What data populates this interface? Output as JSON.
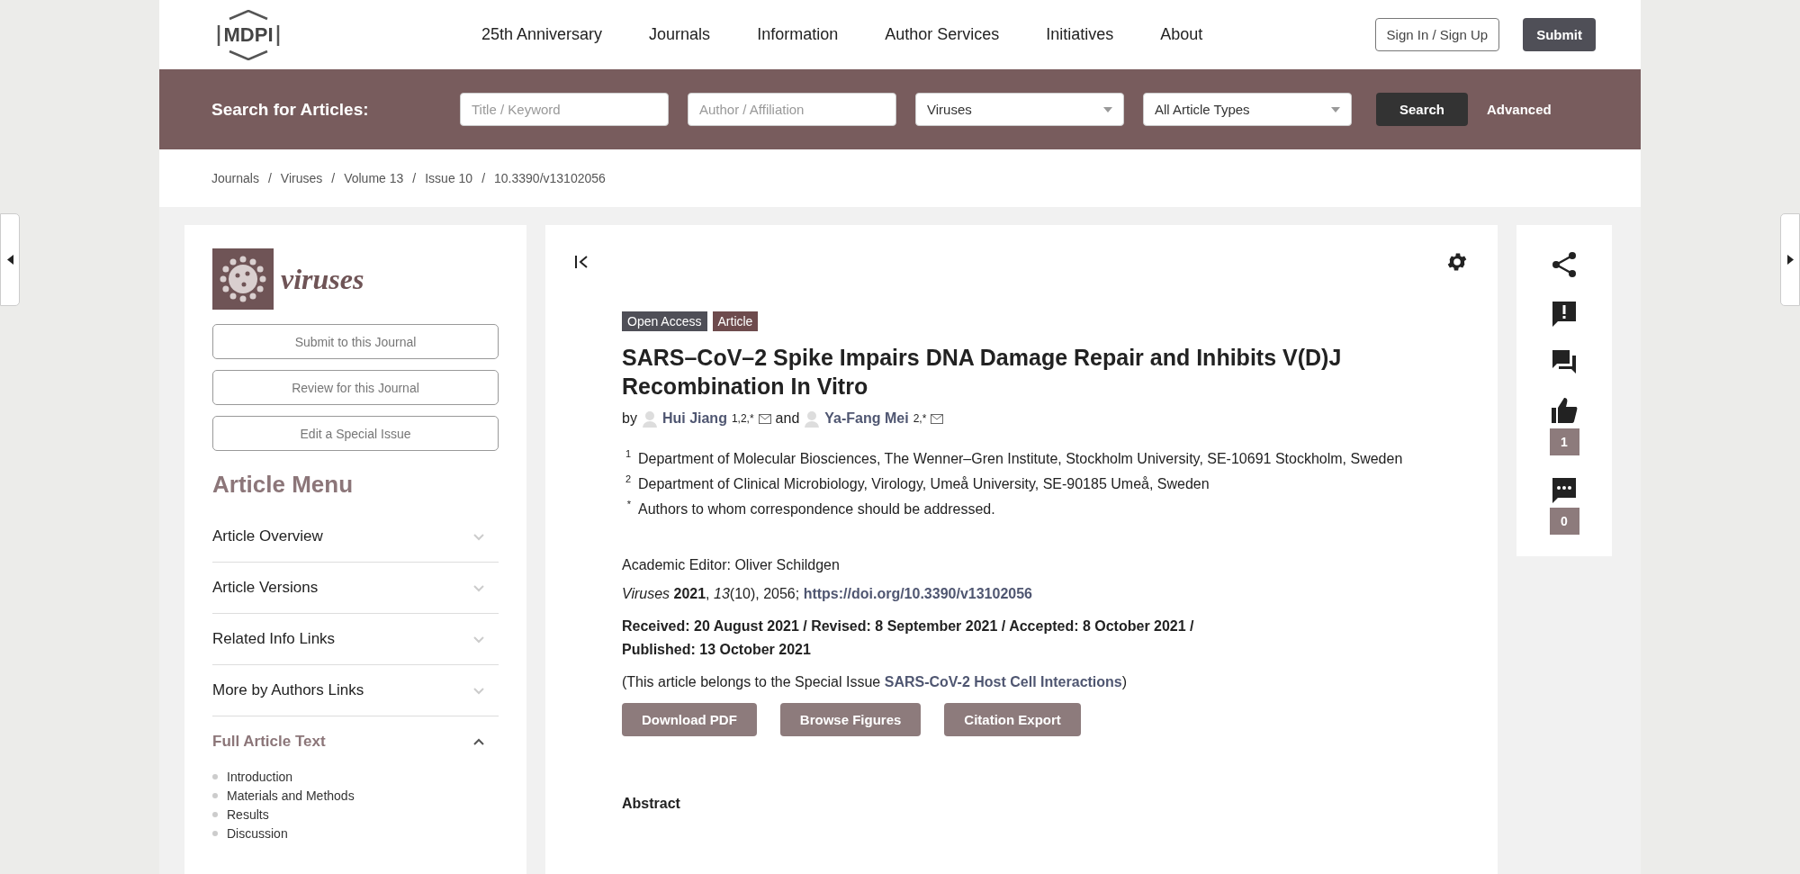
{
  "header": {
    "logo": "MDPI",
    "nav": [
      "25th Anniversary",
      "Journals",
      "Information",
      "Author Services",
      "Initiatives",
      "About"
    ],
    "sign_in": "Sign In / Sign Up",
    "submit": "Submit"
  },
  "search": {
    "label": "Search for Articles:",
    "fields": [
      {
        "kind": "text",
        "placeholder": "Title / Keyword"
      },
      {
        "kind": "text",
        "placeholder": "Author / Affiliation"
      },
      {
        "kind": "select",
        "value": "Viruses"
      },
      {
        "kind": "select",
        "value": "All Article Types"
      }
    ],
    "button": "Search",
    "advanced": "Advanced"
  },
  "breadcrumb": {
    "separator": "/",
    "items": [
      "Journals",
      "Viruses",
      "Volume 13",
      "Issue 10",
      "10.3390/v13102056"
    ]
  },
  "sidebar": {
    "journal": "viruses",
    "buttons": [
      "Submit to this Journal",
      "Review for this Journal",
      "Edit a Special Issue"
    ],
    "menu_title": "Article Menu",
    "menu": [
      {
        "label": "Article Overview",
        "expanded": false
      },
      {
        "label": "Article Versions",
        "expanded": false
      },
      {
        "label": "Related Info Links",
        "expanded": false
      },
      {
        "label": "More by Authors Links",
        "expanded": false
      },
      {
        "label": "Full Article Text",
        "expanded": true,
        "children": [
          "Introduction",
          "Materials and Methods",
          "Results",
          "Discussion"
        ]
      }
    ]
  },
  "article": {
    "badges": [
      {
        "label": "Open Access",
        "kind": "access"
      },
      {
        "label": "Article",
        "kind": "type"
      }
    ],
    "title": "SARS–CoV–2 Spike Impairs DNA Damage Repair and Inhibits V(D)J Recombination In Vitro",
    "by": "by",
    "and": "and",
    "authors": [
      {
        "name": "Hui Jiang",
        "marks": "1,2,*"
      },
      {
        "name": "Ya-Fang Mei",
        "marks": "2,*"
      }
    ],
    "affiliations": [
      {
        "mark": "1",
        "text": "Department of Molecular Biosciences, The Wenner–Gren Institute, Stockholm University, SE-10691 Stockholm, Sweden"
      },
      {
        "mark": "2",
        "text": "Department of Clinical Microbiology, Virology, Umeå University, SE-90185 Umeå, Sweden"
      },
      {
        "mark": "*",
        "text": "Authors to whom correspondence should be addressed."
      }
    ],
    "editor": "Academic Editor: Oliver Schildgen",
    "citation": {
      "text": "*Viruses* **2021**, *13*(10), 2056;",
      "link": "https://doi.org/10.3390/v13102056"
    },
    "dates": "Received: 20 August 2021 / Revised: 8 September 2021 / Accepted: 8 October 2021 / Published: 13 October 2021",
    "special_issue": {
      "before": "(This article belongs to the Special Issue",
      "link": "SARS-CoV-2 Host Cell Interactions",
      "after": ")"
    },
    "buttons": [
      "Download PDF",
      "Browse Figures",
      "Citation Export"
    ],
    "abstract_heading": "Abstract"
  },
  "actions": [
    {
      "kind": "share"
    },
    {
      "kind": "report"
    },
    {
      "kind": "discuss"
    },
    {
      "kind": "like",
      "count": "1"
    },
    {
      "kind": "comment",
      "count": "0"
    }
  ]
}
